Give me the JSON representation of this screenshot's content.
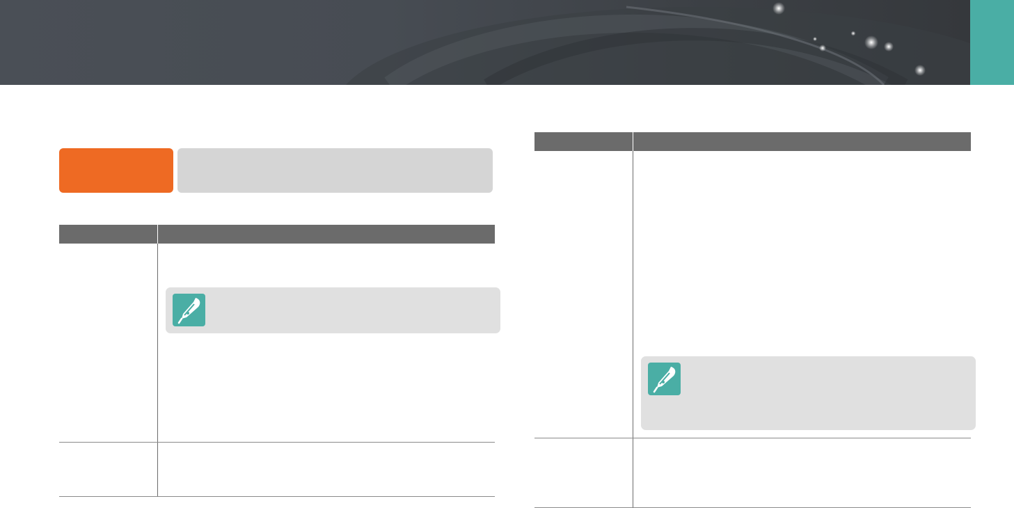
{
  "colors": {
    "banner": "#474c53",
    "accent_teal": "#4aaea5",
    "accent_orange": "#ee6a23",
    "table_header": "#6b6b6b",
    "note_background": "#e0e0e0",
    "heading_description_background": "#d5d5d5"
  },
  "header": {
    "side_tab_color": "#4aaea5"
  },
  "section": {
    "label_color": "#ee6a23"
  },
  "notes": [
    {
      "icon": "pen-note-icon"
    },
    {
      "icon": "pen-note-icon"
    }
  ]
}
